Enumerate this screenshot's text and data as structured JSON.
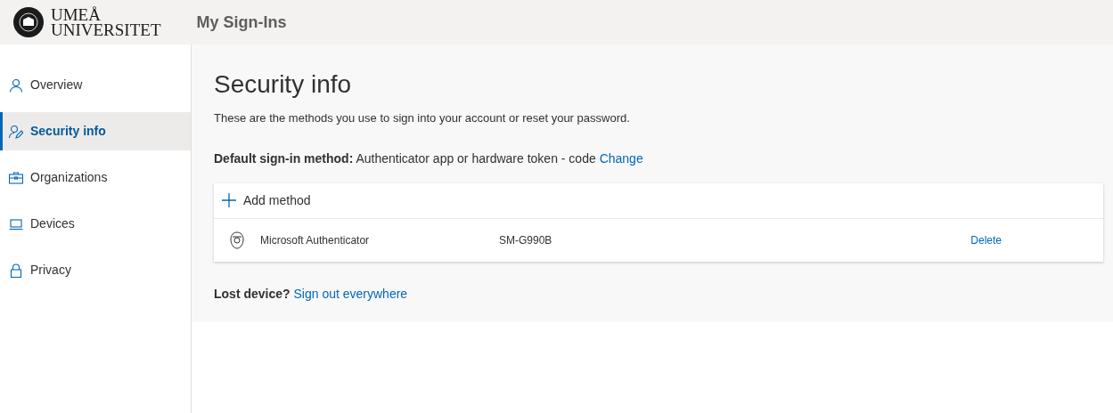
{
  "header": {
    "logo_lines": [
      "UMEÅ",
      "UNIVERSITET"
    ],
    "app_title": "My Sign-Ins"
  },
  "sidebar": {
    "items": [
      {
        "kind": "person",
        "label": "Overview",
        "selected": false
      },
      {
        "kind": "person-edit",
        "label": "Security info",
        "selected": true
      },
      {
        "kind": "briefcase",
        "label": "Organizations",
        "selected": false
      },
      {
        "kind": "laptop",
        "label": "Devices",
        "selected": false
      },
      {
        "kind": "lock",
        "label": "Privacy",
        "selected": false
      }
    ]
  },
  "main": {
    "title": "Security info",
    "description": "These are the methods you use to sign into your account or reset your password.",
    "default_method": {
      "label": "Default sign-in method:",
      "value": "Authenticator app or hardware token - code",
      "link": "Change"
    },
    "add_method": "Add method",
    "methods": [
      {
        "name": "Microsoft Authenticator",
        "device": "SM-G990B",
        "action": "Delete"
      }
    ],
    "lost_device": {
      "label": "Lost device?",
      "link": "Sign out everywhere"
    }
  }
}
